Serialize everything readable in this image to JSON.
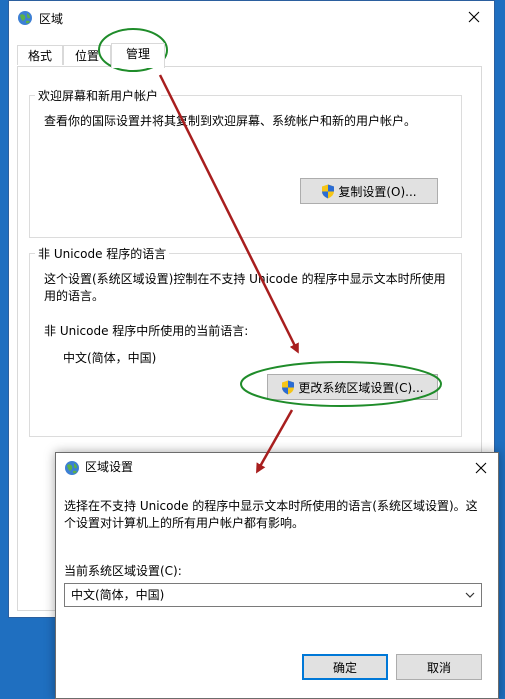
{
  "main_window": {
    "title": "区域",
    "tabs": [
      {
        "label": "格式"
      },
      {
        "label": "位置"
      },
      {
        "label": "管理"
      }
    ],
    "welcome_group": {
      "legend": "欢迎屏幕和新用户帐户",
      "description": "查看你的国际设置并将其复制到欢迎屏幕、系统帐户和新的用户帐户。",
      "copy_button": "复制设置(O)..."
    },
    "unicode_group": {
      "legend": "非 Unicode 程序的语言",
      "description_line1": "这个设置(系统区域设置)控制在不支持 Unicode 的程序中显示文本时所使用",
      "description_line2": "用的语言。",
      "current_label": "非 Unicode 程序中所使用的当前语言:",
      "current_value": "中文(简体，中国)",
      "change_button": "更改系统区域设置(C)..."
    }
  },
  "dialog": {
    "title": "区域设置",
    "description_line1": "选择在不支持 Unicode 的程序中显示文本时所使用的语言(系统区域设置)。这",
    "description_line2": "个设置对计算机上的所有用户帐户都有影响。",
    "current_label": "当前系统区域设置(C):",
    "selected_value": "中文(简体，中国)",
    "ok_button": "确定",
    "cancel_button": "取消"
  },
  "annotation_colors": {
    "circle": "#1f8c2a",
    "arrow": "#a81e1e"
  }
}
